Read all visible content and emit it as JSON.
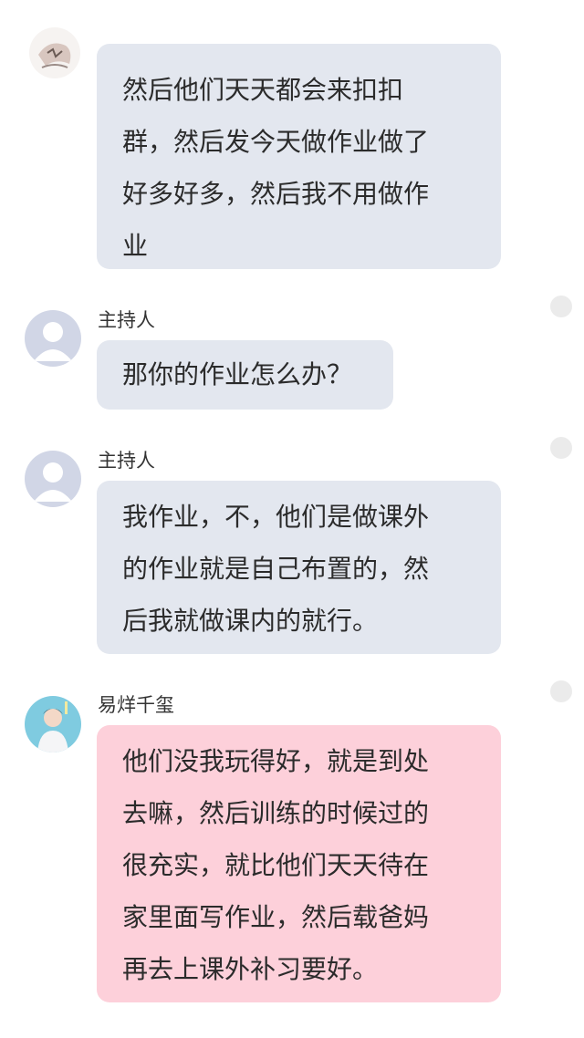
{
  "messages": [
    {
      "role": "guest",
      "sender": "",
      "text": "然后他们天天都会来扣扣\n群，然后发今天做作业做了\n好多好多，然后我不用做作\n业"
    },
    {
      "role": "host",
      "sender": "主持人",
      "text": "那你的作业怎么办？"
    },
    {
      "role": "host",
      "sender": "主持人",
      "text": "我作业，不，他们是做课外\n的作业就是自己布置的，然\n后我就做课内的就行。"
    },
    {
      "role": "guest",
      "sender": "易烊千玺",
      "text": "他们没我玩得好，就是到处\n去嘛，然后训练的时候过的\n很充实，就比他们天天待在\n家里面写作业，然后载爸妈\n再去上课外补习要好。"
    }
  ],
  "icons": {
    "avatar_host": "default-person-avatar-icon",
    "avatar_guest": "person-photo-avatar-icon",
    "status_dot": "status-dot-icon"
  },
  "colors": {
    "host_bubble": "#e3e7ef",
    "guest_bubble": "#fdd0da",
    "dot": "#ebebeb"
  }
}
